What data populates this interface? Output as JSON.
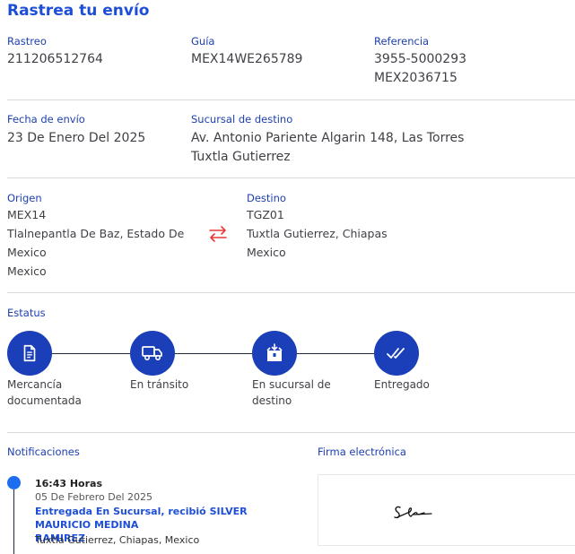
{
  "title": "Rastrea tu envío",
  "info": {
    "rastreo_label": "Rastreo",
    "rastreo_value": "211206512764",
    "guia_label": "Guía",
    "guia_value": "MEX14WE265789",
    "referencia_label": "Referencia",
    "referencia_value_1": "3955-5000293",
    "referencia_value_2": "MEX2036715",
    "fecha_label": "Fecha de envío",
    "fecha_value": "23 De Enero Del 2025",
    "sucursal_label": "Sucursal de destino",
    "sucursal_value_1": "Av. Antonio Pariente Algarin 148, Las Torres",
    "sucursal_value_2": "Tuxtla Gutierrez"
  },
  "route": {
    "origen_label": "Origen",
    "origen_code": "MEX14",
    "origen_line_1": "Tlalnepantla De Baz, Estado De",
    "origen_line_2": "Mexico",
    "origen_line_3": "Mexico",
    "destino_label": "Destino",
    "destino_code": "TGZ01",
    "destino_line_1": "Tuxtla Gutierrez, Chiapas",
    "destino_line_2": "Mexico"
  },
  "status": {
    "label": "Estatus",
    "steps": [
      {
        "line_1": "Mercancía",
        "line_2": "documentada",
        "icon": "document-icon"
      },
      {
        "line_1": "En tránsito",
        "line_2": "",
        "icon": "truck-icon"
      },
      {
        "line_1": "En sucursal de",
        "line_2": "destino",
        "icon": "package-icon"
      },
      {
        "line_1": "Entregado",
        "line_2": "",
        "icon": "double-check-icon"
      }
    ]
  },
  "notifications": {
    "label": "Notificaciones",
    "items": [
      {
        "time": "16:43 Horas",
        "date": "05 De Febrero Del 2025",
        "status_1": "Entregada En Sucursal, recibió SILVER MAURICIO MEDINA",
        "status_2": "RAMIREZ",
        "location": "Tuxtla Gutierrez, Chiapas, Mexico"
      }
    ]
  },
  "signature": {
    "label": "Firma electrónica"
  },
  "colors": {
    "primary": "#1a3fb8",
    "accent_swap": "#e53935",
    "dot": "#1e6cf0"
  }
}
